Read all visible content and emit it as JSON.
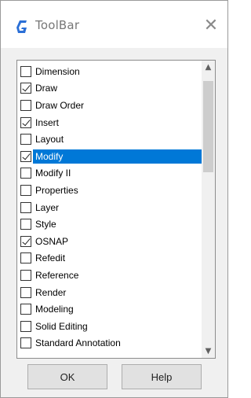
{
  "window": {
    "title": "ToolBar",
    "close_glyph": "✕",
    "app_icon": "autocad-g-icon",
    "accent_color": "#2b6fd6"
  },
  "toolbar_list": {
    "items": [
      {
        "label": "Dimension",
        "checked": false,
        "selected": false
      },
      {
        "label": "Draw",
        "checked": true,
        "selected": false
      },
      {
        "label": "Draw Order",
        "checked": false,
        "selected": false
      },
      {
        "label": "Insert",
        "checked": true,
        "selected": false
      },
      {
        "label": "Layout",
        "checked": false,
        "selected": false
      },
      {
        "label": "Modify",
        "checked": true,
        "selected": true
      },
      {
        "label": "Modify II",
        "checked": false,
        "selected": false
      },
      {
        "label": "Properties",
        "checked": false,
        "selected": false
      },
      {
        "label": "Layer",
        "checked": false,
        "selected": false
      },
      {
        "label": "Style",
        "checked": false,
        "selected": false
      },
      {
        "label": "OSNAP",
        "checked": true,
        "selected": false
      },
      {
        "label": "Refedit",
        "checked": false,
        "selected": false
      },
      {
        "label": "Reference",
        "checked": false,
        "selected": false
      },
      {
        "label": "Render",
        "checked": false,
        "selected": false
      },
      {
        "label": "Modeling",
        "checked": false,
        "selected": false
      },
      {
        "label": "Solid Editing",
        "checked": false,
        "selected": false
      },
      {
        "label": "Standard Annotation",
        "checked": false,
        "selected": false
      }
    ],
    "selection_color": "#0078d7",
    "scroll_up_glyph": "▲",
    "scroll_down_glyph": "▼"
  },
  "buttons": {
    "ok_label": "OK",
    "help_label": "Help"
  }
}
